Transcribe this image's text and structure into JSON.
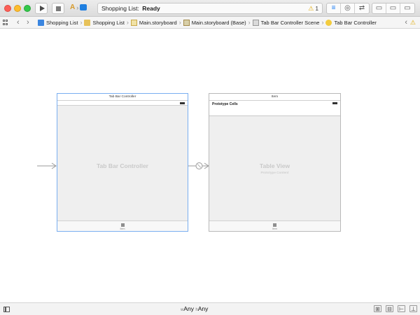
{
  "toolbar": {
    "scheme_app_glyph": "A",
    "scheme_separator": "›",
    "activity_app": "Shopping List:",
    "activity_status": "Ready",
    "warning_count": "1",
    "editor_modes": [
      "≡",
      "◎",
      "⇄"
    ],
    "view_modes": [
      "▭",
      "▭",
      "▭"
    ]
  },
  "jumpbar": {
    "back_arrow": "‹",
    "forward_arrow": "›",
    "separator": "›",
    "crumbs": [
      {
        "label": "Shopping List",
        "icon": "project-icon"
      },
      {
        "label": "Shopping List",
        "icon": "folder-icon"
      },
      {
        "label": "Main.storyboard",
        "icon": "storyboard-icon"
      },
      {
        "label": "Main.storyboard (Base)",
        "icon": "storyboard-base-icon"
      },
      {
        "label": "Tab Bar Controller Scene",
        "icon": "scene-icon"
      },
      {
        "label": "Tab Bar Controller",
        "icon": "tab-bar-controller-icon"
      }
    ],
    "right_back": "‹",
    "right_warning": "⚠"
  },
  "canvas": {
    "tab_bar_controller_scene": {
      "title": "Tab Bar Controller",
      "placeholder": "Tab Bar Controller",
      "tab_label": "Item"
    },
    "table_view_scene": {
      "title": "Item",
      "prototype_cells_label": "Prototype Cells",
      "placeholder": "Table View",
      "placeholder_sub": "Prototype Content",
      "tab_label": "Item"
    }
  },
  "bottombar": {
    "width_prefix": "w",
    "width_value": "Any",
    "height_prefix": "h",
    "height_value": "Any",
    "tools": [
      "⊞",
      "⊟",
      "⊢",
      "⊥"
    ]
  },
  "colors": {
    "accent": "#1a7bf2",
    "warning": "#e0a800",
    "selection_border": "#79aef0",
    "canvas_placeholder_text": "#c9c9c9"
  }
}
